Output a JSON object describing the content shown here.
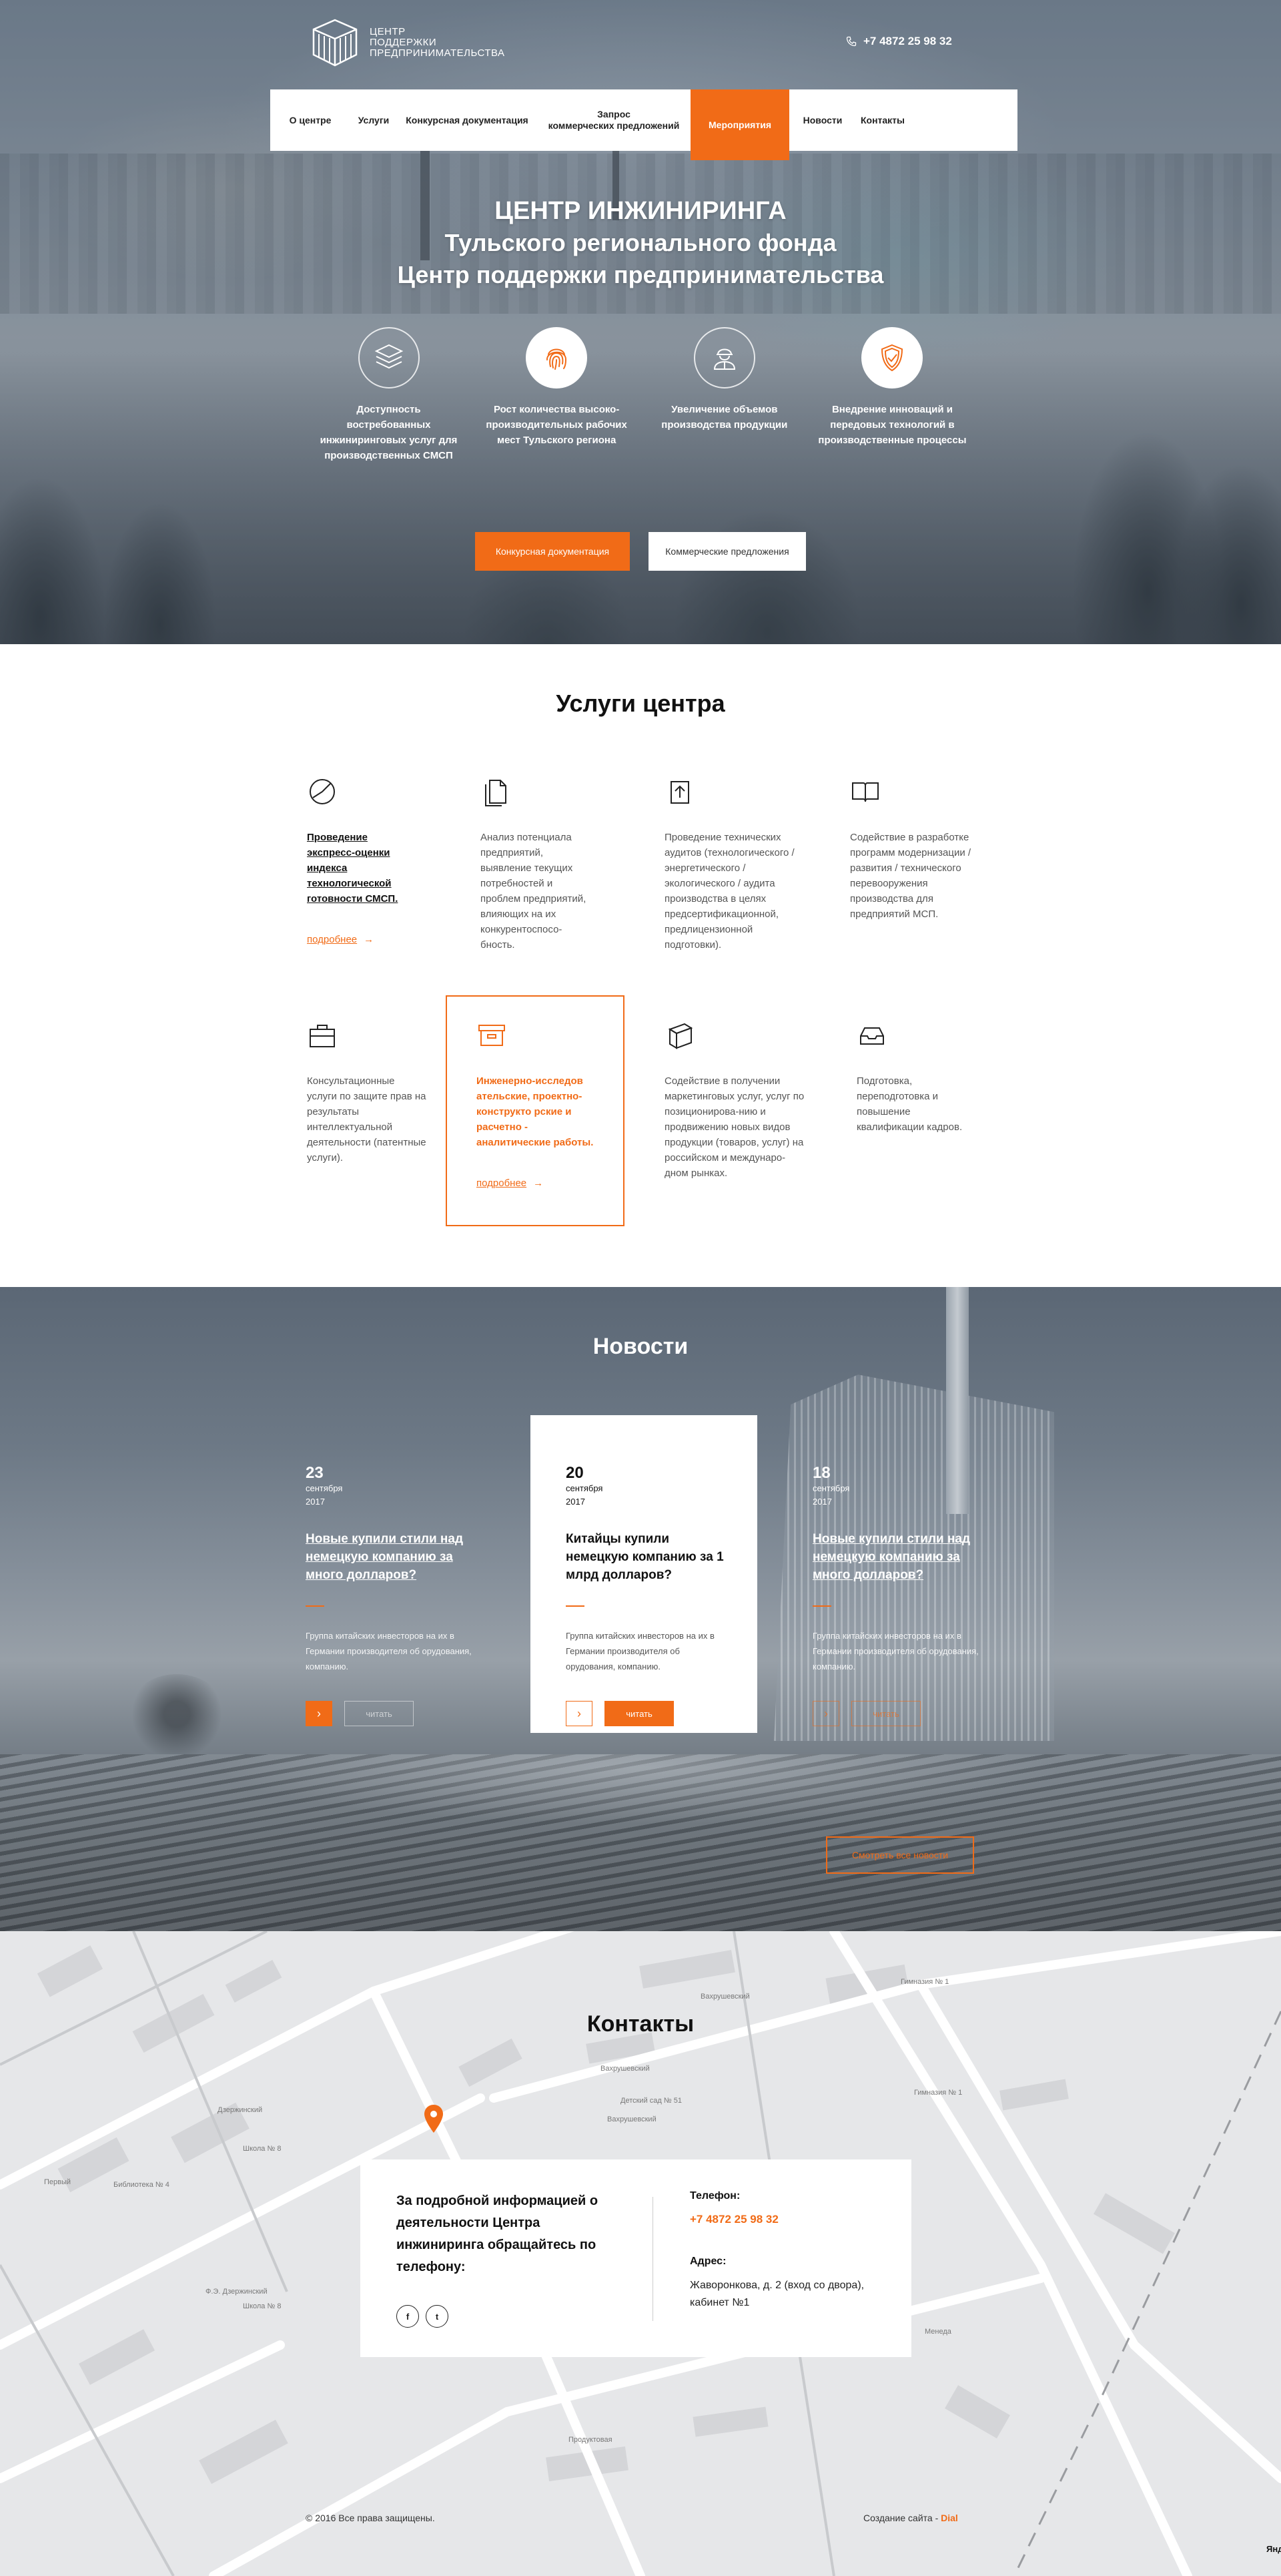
{
  "header": {
    "logo_lines": [
      "ЦЕНТР",
      "ПОДДЕРЖКИ",
      "ПРЕДПРИНИМАТЕЛЬСТВА"
    ],
    "phone": "+7 4872  25 98 32",
    "phone_icon": "phone-icon"
  },
  "nav": {
    "items": [
      {
        "label": "О центре",
        "active": false
      },
      {
        "label": "Услуги",
        "active": false
      },
      {
        "label": "Конкурсная документация",
        "active": false
      },
      {
        "label": "Запрос\nкоммерческих предложений",
        "active": false
      },
      {
        "label": "Мероприятия",
        "active": true
      },
      {
        "label": "Новости",
        "active": false
      },
      {
        "label": "Контакты",
        "active": false
      }
    ]
  },
  "hero": {
    "title_lines": [
      "ЦЕНТР ИНЖИНИРИНГА",
      "Тульского регионального фонда",
      "Центр поддержки предпринимательства"
    ],
    "features": [
      {
        "icon": "layers-icon",
        "text": "Доступность востребованных инжиниринговых услуг для производственных СМСП"
      },
      {
        "icon": "fingerprint-icon",
        "text": "Рост количества высоко-производительных рабочих мест Тульского региона"
      },
      {
        "icon": "worker-icon",
        "text": "Увеличение объемов производства продукции"
      },
      {
        "icon": "shield-check-icon",
        "text": "Внедрение инноваций и передовых технологий в производственные процессы"
      }
    ],
    "btn_primary": "Конкурсная документация",
    "btn_secondary": "Коммерческие предложения"
  },
  "services": {
    "title": "Услуги центра",
    "items": [
      {
        "icon": "pie-chart-icon",
        "text": "Проведение экспресс-оценки индекса технологической готовности СМСП.",
        "style": "strong",
        "more": "подробнее"
      },
      {
        "icon": "document-icon",
        "text": "Анализ потенциала предприятий, выявление текущих потребностей и проблем предприятий, влияющих на их конкурентоспосо-бность.",
        "style": "normal"
      },
      {
        "icon": "upload-icon",
        "text": "Проведение технических аудитов (технологического / энергетического / экологического / аудита производства в целях предсертификационной, предлицензионной подготовки).",
        "style": "normal"
      },
      {
        "icon": "book-icon",
        "text": "Содействие в разработке программ модернизации / развития / технического перевооружения производства для предприятий МСП.",
        "style": "normal"
      },
      {
        "icon": "briefcase-icon",
        "text": "Консультационные услуги по защите прав на результаты интеллектуальной деятельности (патентные услуги).",
        "style": "normal"
      },
      {
        "icon": "archive-icon",
        "text": "Инженерно-исследов ательские, проектно-конструкто рские и расчетно - аналитические работы.",
        "style": "orange",
        "more": "подробнее"
      },
      {
        "icon": "box-icon",
        "text": "Содействие в получении маркетинговых услуг, услуг по позиционирова-нию и продвижению новых видов продукции (товаров, услуг) на российском и междунаро-дном рынках.",
        "style": "normal"
      },
      {
        "icon": "inbox-icon",
        "text": "Подготовка, переподготовка и повышение квалификации кадров.",
        "style": "normal"
      }
    ]
  },
  "news": {
    "title": "Новости",
    "items": [
      {
        "day": "23",
        "month": "сентября",
        "year": "2017",
        "headline": "Новые купили стили над немецкую компанию за много долларов?",
        "text": "Группа китайских инвесторов на их в Германии производителя об орудования, компанию.",
        "read": "читать"
      },
      {
        "day": "20",
        "month": "сентября",
        "year": "2017",
        "headline": "Китайцы купили немецкую компанию за 1 млрд долларов?",
        "text": "Группа китайских инвесторов на их в Германии производителя об орудования, компанию.",
        "read": "читать"
      },
      {
        "day": "18",
        "month": "сентября",
        "year": "2017",
        "headline": "Новые купили стили над немецкую компанию за много долларов?",
        "text": "Группа китайских инвесторов на их в Германии производителя об орудования, компанию.",
        "read": "читать"
      }
    ],
    "all": "Смотреть все новости"
  },
  "contacts": {
    "title": "Контакты",
    "intro": "За подробной информацией о деятельности Центра инжиниринга обращайтесь по телефону:",
    "social": [
      {
        "icon": "facebook-icon",
        "glyph": "f"
      },
      {
        "icon": "twitter-icon",
        "glyph": "t"
      }
    ],
    "phone_label": "Телефон:",
    "phone": "+7  4872  25 98 32",
    "address_label": "Адрес:",
    "address": "Жаворонкова, д. 2 (вход со двора), кабинет №1",
    "map_labels": [
      "Вахрушевский",
      "Вахрушевский",
      "Вахрушевский",
      "Гимназия № 1",
      "Детский сад № 51",
      "Гимназия № 1",
      "Библиотека № 4",
      "Школа № 8",
      "Школа № 8",
      "Ф.Э. Дзержинский",
      "Дзержинский",
      "Первый",
      "Продуктовая",
      "Менеда",
      "Яндекс"
    ],
    "copyright": "© 2016 Все права защищены.",
    "made_by_prefix": "Создание сайта - ",
    "made_by": "Dial",
    "yandex": "Янд"
  }
}
